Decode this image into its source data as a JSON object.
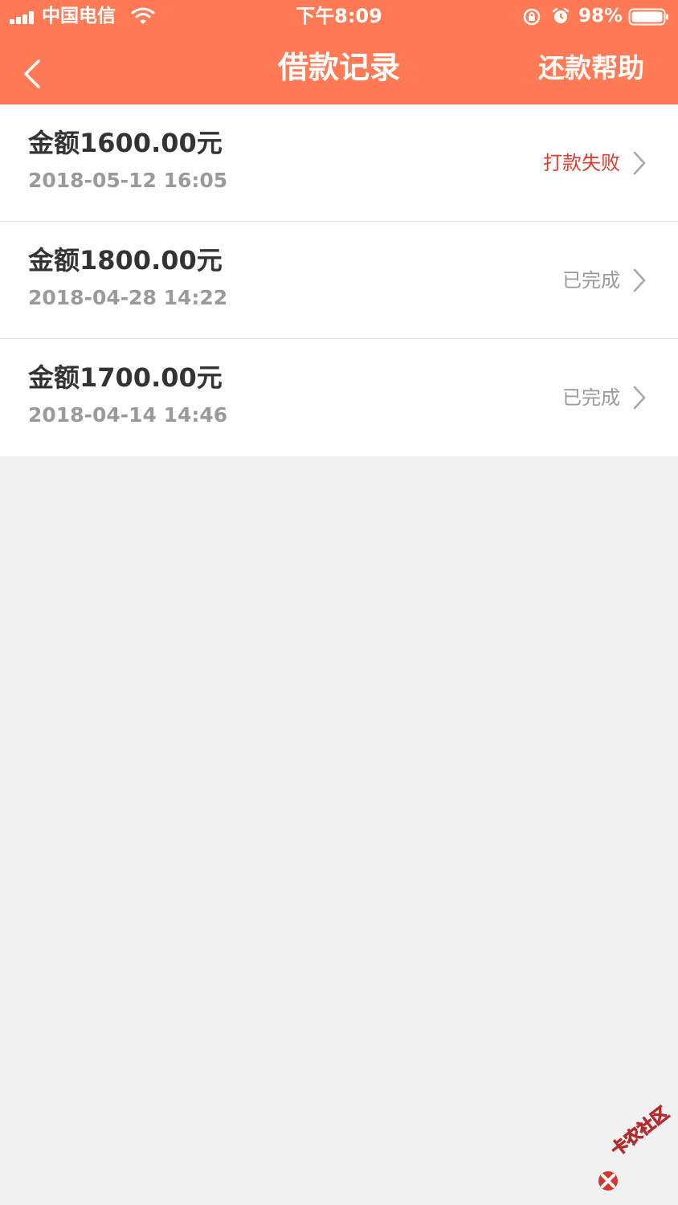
{
  "status_bar": {
    "carrier": "中国电信",
    "time": "下午8:09",
    "battery_percent": "98%"
  },
  "nav": {
    "title": "借款记录",
    "help": "还款帮助"
  },
  "records": [
    {
      "amount": "金额1600.00元",
      "date": "2018-05-12 16:05",
      "status": "打款失败",
      "status_color": "#e23b2f"
    },
    {
      "amount": "金额1800.00元",
      "date": "2018-04-28 14:22",
      "status": "已完成",
      "status_color": "#9a9a9a"
    },
    {
      "amount": "金额1700.00元",
      "date": "2018-04-14 14:46",
      "status": "已完成",
      "status_color": "#9a9a9a"
    }
  ],
  "watermark": {
    "text": "卡农社区"
  },
  "colors": {
    "header_bg": "#ff7a55",
    "page_bg": "#f1f1f1",
    "card_bg": "#ffffff"
  }
}
